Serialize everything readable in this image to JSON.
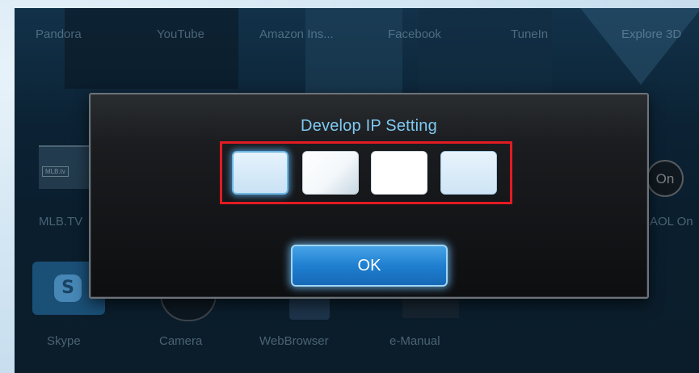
{
  "top_apps": [
    "Pandora",
    "YouTube",
    "Amazon Ins...",
    "Facebook",
    "TuneIn",
    "Explore 3D"
  ],
  "middle_apps": {
    "left_label": "MLB.TV",
    "left_tag": "MLB.tv",
    "right_label": "AOL On",
    "right_icon_text": "On"
  },
  "bottom_apps": [
    "Skype",
    "Camera",
    "WebBrowser",
    "e-Manual"
  ],
  "bottom_icons": {
    "skype_glyph": "S"
  },
  "dialog": {
    "title": "Develop IP Setting",
    "ip_fields": [
      "",
      "",
      "",
      ""
    ],
    "ok_label": "OK"
  },
  "colors": {
    "title_text": "#7fc9f2",
    "highlight_border": "#e31b23",
    "ok_button": "#1f7fd0"
  }
}
